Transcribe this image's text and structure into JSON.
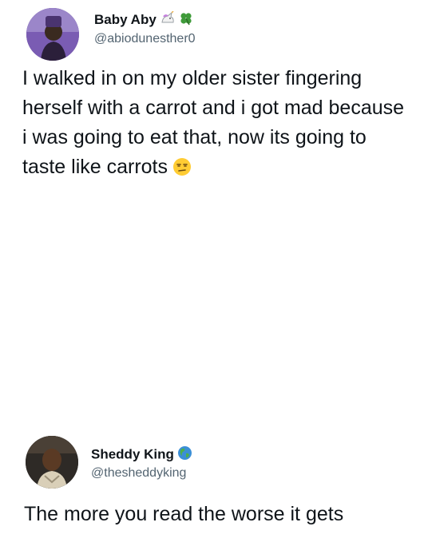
{
  "tweets": [
    {
      "display_name": "Baby Aby",
      "handle": "@abiodunesther0",
      "name_icons": [
        "unicorn-icon",
        "four-leaf-clover-icon"
      ],
      "text": "I walked in on my older sister fingering herself with a carrot and i got mad because i was going to eat that, now its going to taste like carrots",
      "trailing_icon": "unamused-face-icon"
    },
    {
      "display_name": "Sheddy King",
      "handle": "@thesheddyking",
      "name_icons": [
        "globe-icon"
      ],
      "text": "The more you read the worse it gets"
    }
  ]
}
